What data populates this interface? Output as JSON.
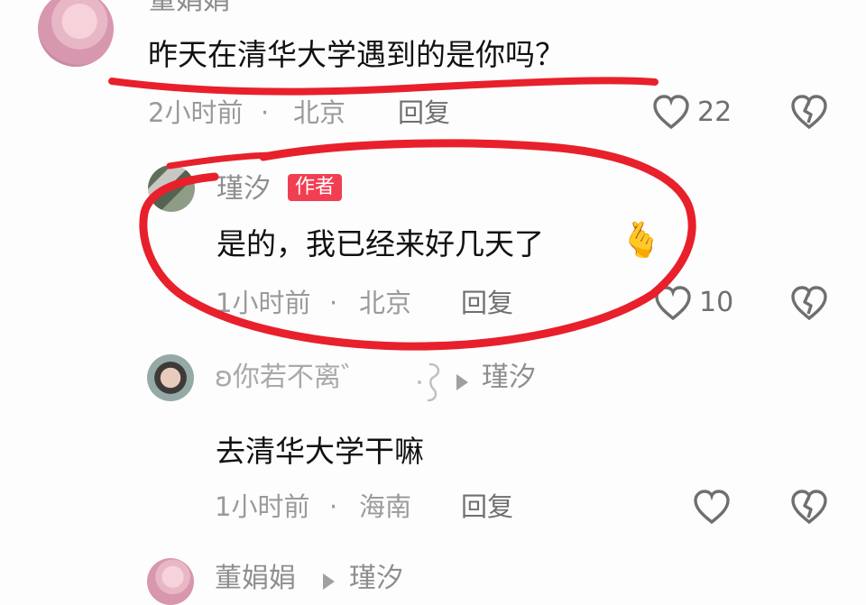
{
  "comments": [
    {
      "author": "董娟娟",
      "text": "昨天在清华大学遇到的是你吗？",
      "time": "2小时前",
      "location": "北京",
      "reply_label": "回复",
      "likes": "22"
    },
    {
      "author": "瑾汐",
      "badge": "作者",
      "text": "是的，我已经来好几天了",
      "emoji": "🫰",
      "time": "1小时前",
      "location": "北京",
      "reply_label": "回复",
      "likes": "10"
    },
    {
      "author": "ʚ你若不离゛",
      "reply_to": "瑾汐",
      "text": "去清华大学干嘛",
      "time": "1小时前",
      "location": "海南",
      "reply_label": "回复"
    },
    {
      "author": "董娟娟",
      "reply_to": "瑾汐"
    }
  ],
  "separator": "·",
  "colors": {
    "annotation_red": "#e8202b",
    "author_badge": "#f23e52",
    "secondary_text": "#9a9a9a"
  },
  "icons": [
    "heart-icon",
    "broken-heart-icon",
    "reply-arrow-icon"
  ]
}
